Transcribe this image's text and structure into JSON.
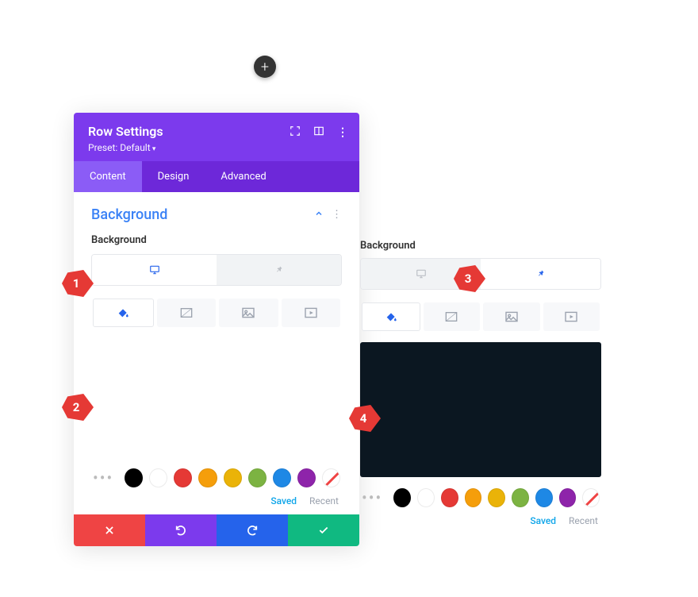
{
  "add_button_label": "+",
  "panel": {
    "title": "Row Settings",
    "preset": "Preset: Default",
    "tabs": {
      "content": "Content",
      "design": "Design",
      "advanced": "Advanced"
    },
    "section_title": "Background",
    "label": "Background",
    "swatches": {
      "colors": [
        "#000000",
        "#ffffff",
        "#e53935",
        "#f59e0b",
        "#eab308",
        "#65a30d",
        "#2563eb",
        "#9333ea"
      ],
      "saved": "Saved",
      "recent": "Recent"
    }
  },
  "right": {
    "label": "Background",
    "swatches": {
      "saved": "Saved",
      "recent": "Recent"
    },
    "preview_color": "#0b1721"
  },
  "markers": {
    "m1": "1",
    "m2": "2",
    "m3": "3",
    "m4": "4"
  }
}
